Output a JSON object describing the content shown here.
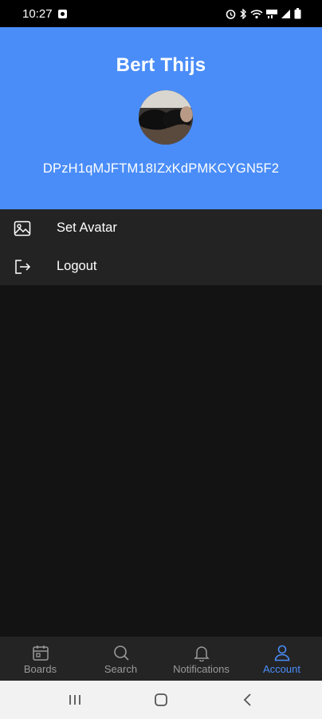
{
  "status_bar": {
    "time": "10:27",
    "icons": [
      "app-notification-icon",
      "alarm-icon",
      "bluetooth-icon",
      "wifi-icon",
      "volte-icon",
      "signal-icon",
      "battery-icon"
    ]
  },
  "profile": {
    "name": "Bert Thijs",
    "user_id": "DPzH1qMJFTM18IZxKdPMKCYGN5F2"
  },
  "menu": {
    "items": [
      {
        "label": "Set Avatar",
        "icon": "image-icon"
      },
      {
        "label": "Logout",
        "icon": "logout-icon"
      }
    ]
  },
  "bottom_nav": {
    "items": [
      {
        "label": "Boards",
        "icon": "calendar-icon"
      },
      {
        "label": "Search",
        "icon": "search-icon"
      },
      {
        "label": "Notifications",
        "icon": "bell-icon"
      },
      {
        "label": "Account",
        "icon": "person-icon",
        "active": true
      }
    ]
  },
  "colors": {
    "header": "#4a8df8",
    "accent": "#4a8df8",
    "background": "#131313",
    "menu_bg": "#232323",
    "nav_bg": "#242424"
  }
}
